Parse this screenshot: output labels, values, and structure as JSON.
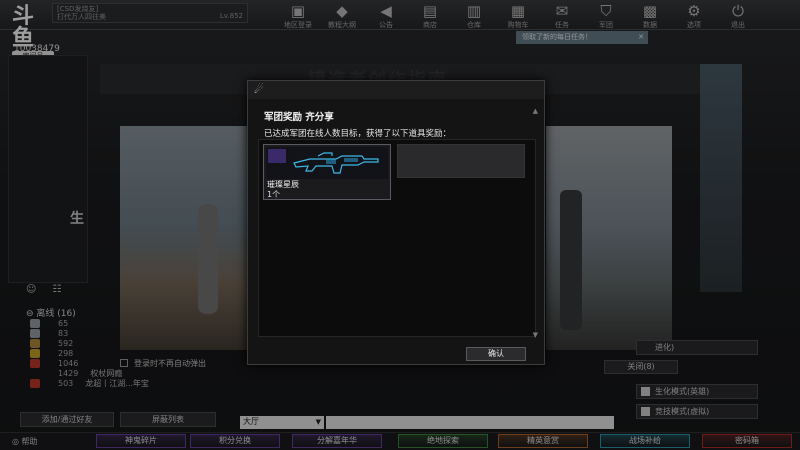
{
  "stream": {
    "logo": "斗鱼",
    "room_label": "房间号",
    "room_id": "10038479"
  },
  "player": {
    "server": "[CSD发烧友]",
    "name": "打代万人四往美",
    "level": "Lv.852"
  },
  "top_nav": [
    {
      "label": "地区登录",
      "icon": "monitor-icon",
      "glyph": "▣"
    },
    {
      "label": "教程大纲",
      "icon": "cap-icon",
      "glyph": "◆"
    },
    {
      "label": "公告",
      "icon": "megaphone-icon",
      "glyph": "◀"
    },
    {
      "label": "商店",
      "icon": "shop-icon",
      "glyph": "▤"
    },
    {
      "label": "仓库",
      "icon": "warehouse-icon",
      "glyph": "▥"
    },
    {
      "label": "购物车",
      "icon": "cart-icon",
      "glyph": "▦"
    },
    {
      "label": "任务",
      "icon": "task-icon",
      "glyph": "✉"
    },
    {
      "label": "军团",
      "icon": "shield-icon",
      "glyph": "⛉"
    },
    {
      "label": "数据",
      "icon": "data-icon",
      "glyph": "▩"
    },
    {
      "label": "选项",
      "icon": "gear-icon",
      "glyph": "⚙"
    },
    {
      "label": "退出",
      "icon": "power-icon",
      "glyph": "⏻"
    }
  ],
  "task_banner": {
    "text": "领取了新的每日任务！",
    "close": "✕"
  },
  "background": {
    "heading": "镜造者创作指南",
    "left_label": "生"
  },
  "friends": {
    "group_label": "离线 (16)",
    "rows": [
      {
        "num": "65",
        "name": "",
        "color": "#9aa0a6"
      },
      {
        "num": "83",
        "name": "",
        "color": "#9aa0a6"
      },
      {
        "num": "592",
        "name": "",
        "color": "#b08a3a"
      },
      {
        "num": "298",
        "name": "",
        "color": "#c9a227"
      },
      {
        "num": "1046",
        "name": "",
        "color": "#c0392b"
      },
      {
        "num": "1429",
        "name": "权杖网瘾",
        "color": ""
      },
      {
        "num": "503",
        "name": "龙超丨江湖...年宝",
        "color": "#c0392b"
      }
    ],
    "add_button": "添加/通过好友",
    "block_button": "屏蔽列表"
  },
  "chat": {
    "channel": "大厅",
    "placeholder": ""
  },
  "background_buttons": {
    "login_popup_checkbox": "登录时不再自动弹出",
    "close_button": "关闭(8)",
    "advance": "进化)"
  },
  "modes": [
    {
      "label": "生化模式(英雄)"
    },
    {
      "label": "竞技模式(虚拟)"
    }
  ],
  "bottom_bar": {
    "help": "帮助",
    "tabs": [
      {
        "label": "神鬼碎片",
        "color": "#6a3fa0"
      },
      {
        "label": "积分兑换",
        "color": "#6a3fa0"
      },
      {
        "label": "分解嘉年华",
        "color": "#6a3fa0"
      },
      {
        "label": "绝地探索",
        "color": "#3a8a3a"
      },
      {
        "label": "精英意赏",
        "color": "#b5652a"
      },
      {
        "label": "战场补给",
        "color": "#2a9ab5"
      },
      {
        "label": "密码箱",
        "color": "#b52a2a"
      }
    ]
  },
  "dialog": {
    "title": "军团奖励 齐分享",
    "description": "已达成军团在线人数目标，获得了以下道具奖励：",
    "reward_name": "璀璨星辰",
    "reward_qty": "1个",
    "confirm": "确认",
    "accent_color": "#3fb7e8"
  }
}
